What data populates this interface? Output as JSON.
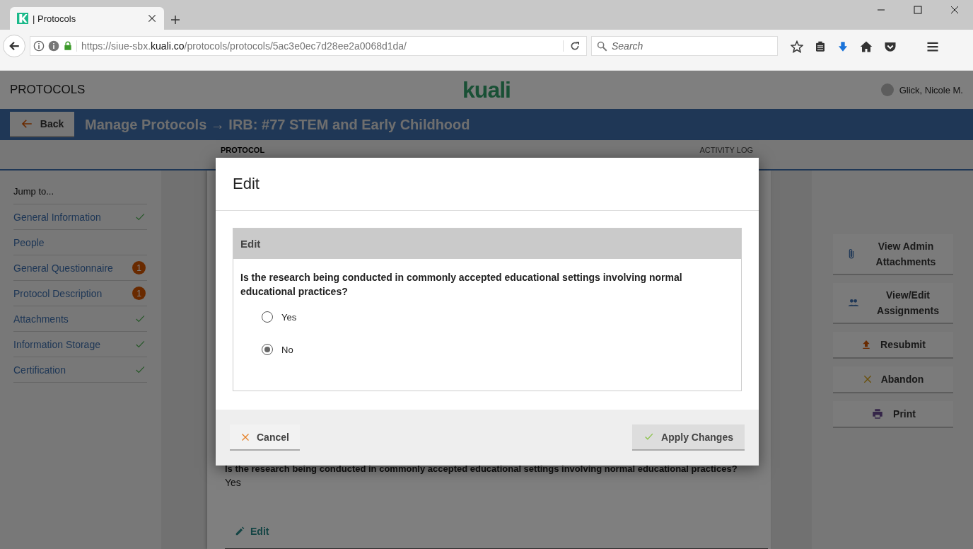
{
  "browser": {
    "tab_title": "| Protocols",
    "address": {
      "prefix": "https://siue-sbx.",
      "host": "kuali.co",
      "path": "/protocols/protocols/5ac3e0ec7d28ee2a0068d1da/"
    },
    "search": {
      "placeholder": "Search"
    }
  },
  "header": {
    "app_name": "PROTOCOLS",
    "logo": "kuali",
    "user": "Glick, Nicole M."
  },
  "title_bar": {
    "back": "Back",
    "title": "Manage Protocols → IRB: #77 STEM and Early Childhood"
  },
  "tabs": [
    {
      "label": "PROTOCOL",
      "selected": true
    },
    {
      "label": "ACTIVITY LOG",
      "selected": false
    }
  ],
  "sidebar": {
    "heading": "Jump to...",
    "items": [
      {
        "label": "General Information",
        "kind": "complete"
      },
      {
        "label": "People",
        "kind": "plain"
      },
      {
        "label": "General Questionnaire",
        "kind": "badge",
        "count": "1"
      },
      {
        "label": "Protocol Description",
        "kind": "badge",
        "count": "1"
      },
      {
        "label": "Attachments",
        "kind": "complete"
      },
      {
        "label": "Information Storage",
        "kind": "complete"
      },
      {
        "label": "Certification",
        "kind": "complete"
      }
    ]
  },
  "actions": [
    {
      "label": "View Admin Attachments",
      "kind": "attach"
    },
    {
      "label": "View/Edit Assignments",
      "kind": "assign"
    },
    {
      "label": "Resubmit",
      "kind": "resubmit"
    },
    {
      "label": "Abandon",
      "kind": "abandon"
    },
    {
      "label": "Print",
      "kind": "print"
    }
  ],
  "background_question": {
    "question": "Is the research being conducted in commonly accepted educational settings involving normal educational practices?",
    "answer": "Yes",
    "edit": "Edit"
  },
  "modal": {
    "title": "Edit",
    "panel_title": "Edit",
    "question": "Is the research being conducted in commonly accepted educational settings involving normal educational practices?",
    "options": [
      {
        "label": "Yes",
        "selected": false
      },
      {
        "label": "No",
        "selected": true
      }
    ],
    "cancel": "Cancel",
    "apply": "Apply Changes"
  }
}
